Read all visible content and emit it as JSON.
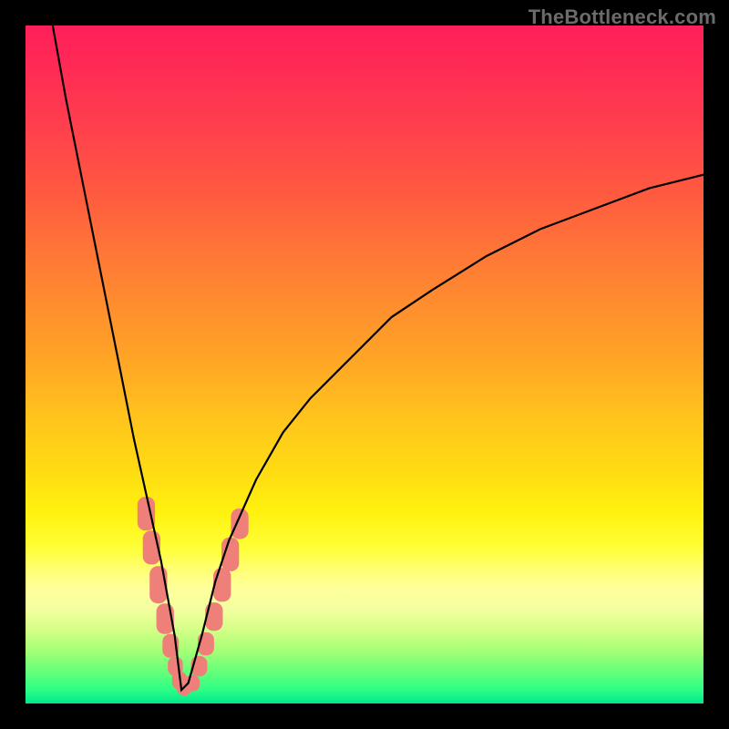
{
  "watermark": "TheBottleneck.com",
  "colors": {
    "frame": "#000000",
    "curve_stroke": "#000000",
    "bead_fill": "#ef8079"
  },
  "chart_data": {
    "type": "line",
    "title": "",
    "xlabel": "",
    "ylabel": "",
    "xlim": [
      0,
      100
    ],
    "ylim": [
      0,
      100
    ],
    "notes": "V-shaped bottleneck curve. Value ≈ |x − x_min| scaled; minimum at x≈23 where y≈0. Left branch rises steeply to y≈100 at x≈4; right branch rises with diminishing slope to y≈78 at x=100.",
    "series": [
      {
        "name": "bottleneck-curve",
        "x": [
          4,
          6,
          8,
          10,
          12,
          14,
          16,
          18,
          20,
          22,
          23,
          24,
          26,
          28,
          30,
          34,
          38,
          42,
          48,
          54,
          60,
          68,
          76,
          84,
          92,
          100
        ],
        "y": [
          100,
          89,
          79,
          69,
          59,
          49,
          39,
          30,
          21,
          10,
          2,
          3,
          10,
          18,
          24,
          33,
          40,
          45,
          51,
          57,
          61,
          66,
          70,
          73,
          76,
          78
        ]
      }
    ],
    "markers": {
      "name": "highlight-beads",
      "shape": "rounded-rect",
      "points": [
        {
          "x": 17.8,
          "y": 28.0,
          "w": 2.6,
          "h": 5.0
        },
        {
          "x": 18.6,
          "y": 23.0,
          "w": 2.6,
          "h": 5.0
        },
        {
          "x": 19.6,
          "y": 17.5,
          "w": 2.6,
          "h": 5.5
        },
        {
          "x": 20.6,
          "y": 12.5,
          "w": 2.6,
          "h": 4.5
        },
        {
          "x": 21.4,
          "y": 8.5,
          "w": 2.4,
          "h": 3.5
        },
        {
          "x": 22.1,
          "y": 5.5,
          "w": 2.2,
          "h": 2.8
        },
        {
          "x": 22.7,
          "y": 3.4,
          "w": 2.2,
          "h": 2.6
        },
        {
          "x": 23.4,
          "y": 2.3,
          "w": 2.2,
          "h": 2.2
        },
        {
          "x": 24.6,
          "y": 3.0,
          "w": 2.2,
          "h": 2.4
        },
        {
          "x": 25.6,
          "y": 5.5,
          "w": 2.4,
          "h": 3.0
        },
        {
          "x": 26.6,
          "y": 8.8,
          "w": 2.4,
          "h": 3.4
        },
        {
          "x": 27.8,
          "y": 12.8,
          "w": 2.6,
          "h": 4.2
        },
        {
          "x": 29.0,
          "y": 17.5,
          "w": 2.6,
          "h": 5.0
        },
        {
          "x": 30.2,
          "y": 22.0,
          "w": 2.6,
          "h": 5.0
        },
        {
          "x": 31.6,
          "y": 26.5,
          "w": 2.6,
          "h": 4.5
        }
      ]
    }
  }
}
